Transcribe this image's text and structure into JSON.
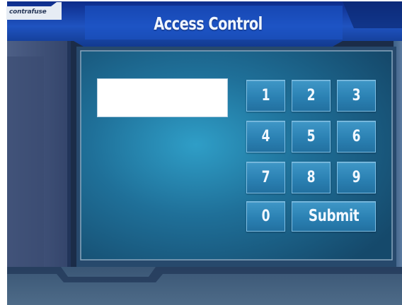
{
  "app": {
    "brand": "contrafuse",
    "title": "Access Control"
  },
  "code_display": {
    "value": ""
  },
  "keypad": {
    "keys": [
      "1",
      "2",
      "3",
      "4",
      "5",
      "6",
      "7",
      "8",
      "9",
      "0"
    ],
    "submit_label": "Submit"
  },
  "colors": {
    "background_blue": "#1f5f7f",
    "key_blue": "#2b81b3",
    "title_bar_blue": "#1b4bb0"
  }
}
